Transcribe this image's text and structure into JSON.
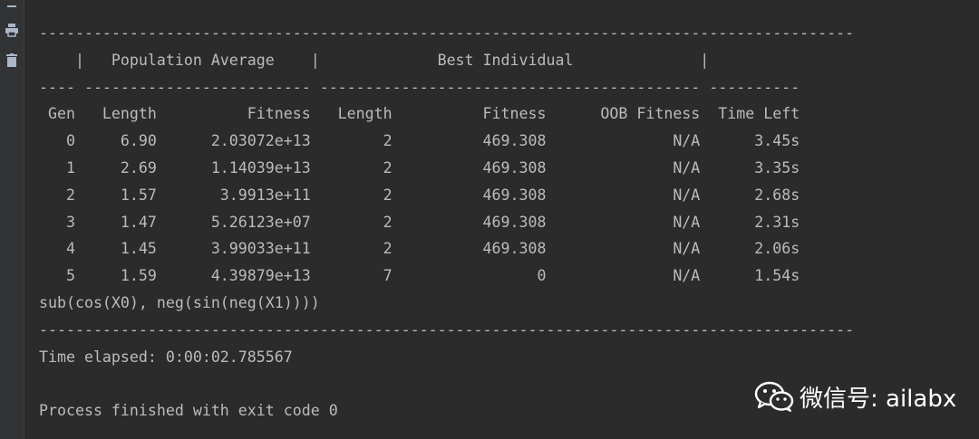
{
  "console": {
    "lines": [
      "------------------------------------------------------------------------------------------",
      "    |   Population Average    |             Best Individual              |",
      "---- ------------------------- ------------------------------------------ ----------",
      " Gen   Length          Fitness   Length          Fitness      OOB Fitness  Time Left",
      "   0     6.90      2.03072e+13        2          469.308              N/A      3.45s",
      "   1     2.69      1.14039e+13        2          469.308              N/A      3.35s",
      "   2     1.57       3.9913e+11        2          469.308              N/A      2.68s",
      "   3     1.47      5.26123e+07        2          469.308              N/A      2.31s",
      "   4     1.45      3.99033e+11        2          469.308              N/A      2.06s",
      "   5     1.59      4.39879e+13        7                0              N/A      1.54s",
      "sub(cos(X0), neg(sin(neg(X1))))",
      "------------------------------------------------------------------------------------------",
      "Time elapsed: 0:00:02.785567",
      "",
      "Process finished with exit code 0"
    ]
  },
  "watermark": {
    "text": "微信号: ailabx",
    "icon": "wechat-icon"
  },
  "gutter": {
    "icons": [
      "menu-icon",
      "print-icon",
      "trash-icon"
    ]
  },
  "colors": {
    "background": "#2b2b2b",
    "text": "#bbbbbb",
    "gutter": "#313335"
  }
}
